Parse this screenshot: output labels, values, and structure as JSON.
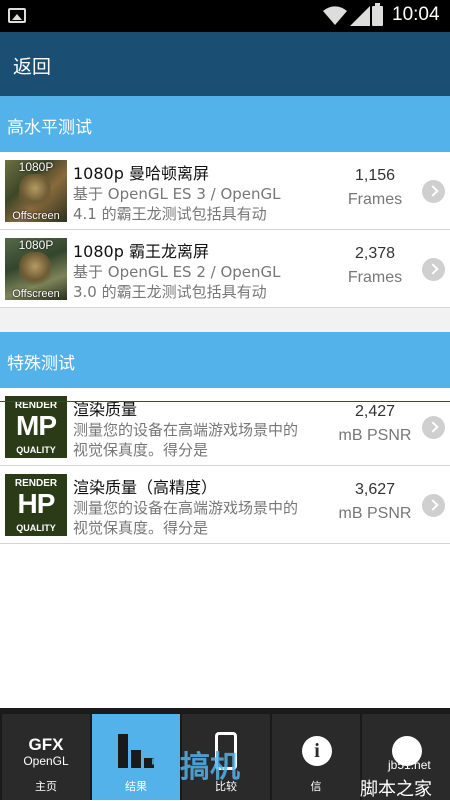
{
  "statusbar": {
    "time": "10:04"
  },
  "appbar": {
    "back_label": "返回"
  },
  "sections": [
    {
      "title": "高水平测试",
      "items": [
        {
          "thumb_top": "1080P",
          "thumb_bottom": "Offscreen",
          "title": "1080p 曼哈顿离屏",
          "desc": "基于 OpenGL ES 3 / OpenGL 4.1 的霸王龙测试包括具有动",
          "value": "1,156",
          "unit": "Frames"
        },
        {
          "thumb_top": "1080P",
          "thumb_bottom": "Offscreen",
          "title": "1080p 霸王龙离屏",
          "desc": "基于 OpenGL ES 2 / OpenGL 3.0 的霸王龙测试包括具有动",
          "value": "2,378",
          "unit": "Frames"
        }
      ]
    },
    {
      "title": "特殊测试",
      "items": [
        {
          "thumb_top": "RENDER",
          "thumb_mid": "MP",
          "thumb_bottom": "QUALITY",
          "title": "渲染质量",
          "desc": "测量您的设备在高端游戏场景中的视觉保真度。得分是",
          "value": "2,427",
          "unit": "mB PSNR"
        },
        {
          "thumb_top": "RENDER",
          "thumb_mid": "HP",
          "thumb_bottom": "QUALITY",
          "title": "渲染质量（高精度）",
          "desc": "测量您的设备在高端游戏场景中的视觉保真度。得分是",
          "value": "3,627",
          "unit": "mB PSNR"
        }
      ]
    }
  ],
  "bottom_nav": {
    "items": [
      {
        "icon": "gfx-opengl-logo",
        "logo_line1": "GFX",
        "logo_line2": "OpenGL",
        "label": "主页",
        "active": false
      },
      {
        "icon": "bar-chart-icon",
        "label": "结果",
        "active": true
      },
      {
        "icon": "phone-icon",
        "label": "比较",
        "active": false
      },
      {
        "icon": "info-icon",
        "label": "信",
        "active": false
      },
      {
        "icon": "more-icon",
        "label": "",
        "active": false
      }
    ]
  },
  "watermark": {
    "text1": "爱搞机",
    "text2": "jb51.net",
    "text3": "脚本之家"
  },
  "colors": {
    "appbar": "#1a4f73",
    "accent": "#54b2ea",
    "nav_bg": "#2a2a2a"
  }
}
